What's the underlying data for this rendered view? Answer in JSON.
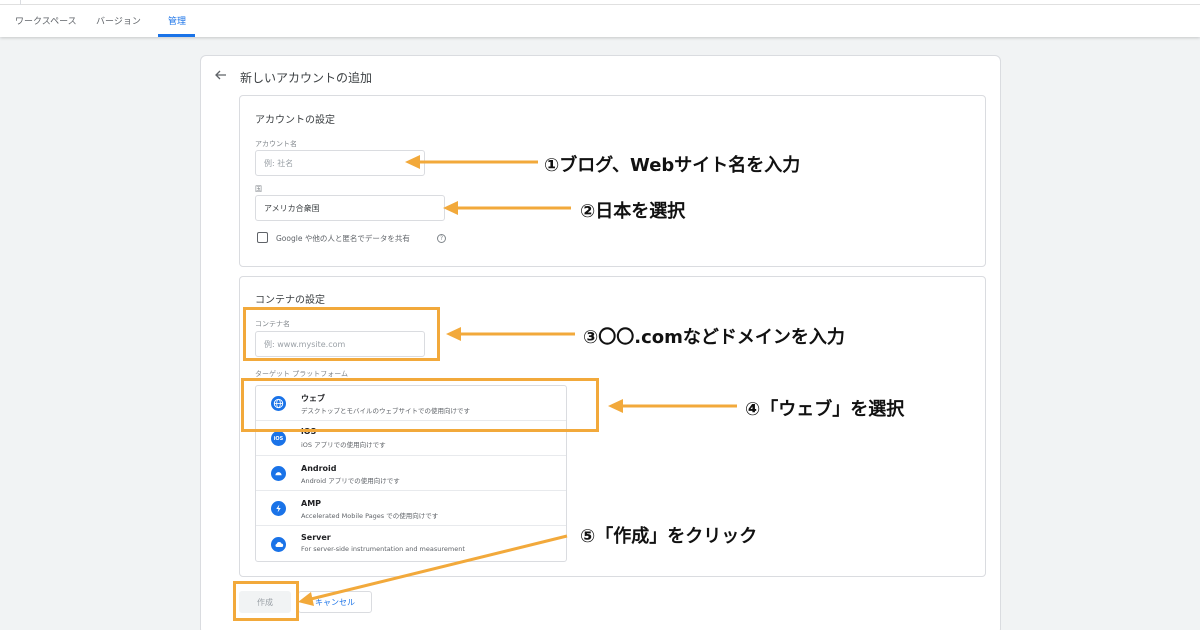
{
  "header": {
    "tabs": [
      {
        "label": "ワークスペース"
      },
      {
        "label": "バージョン"
      },
      {
        "label": "管理"
      }
    ],
    "active_tab": "管理"
  },
  "page": {
    "title": "新しいアカウントの追加"
  },
  "account_section": {
    "title": "アカウントの設定",
    "name_label": "アカウント名",
    "name_placeholder": "例: 社名",
    "country_label": "国",
    "country_value": "アメリカ合衆国",
    "share_label": "Google や他の人と匿名でデータを共有"
  },
  "container_section": {
    "title": "コンテナの設定",
    "name_label": "コンテナ名",
    "name_placeholder": "例: www.mysite.com",
    "platform_label": "ターゲット プラットフォーム",
    "platforms": [
      {
        "name": "ウェブ",
        "desc": "デスクトップとモバイルのウェブサイトでの使用向けです",
        "icon": "globe-icon"
      },
      {
        "name": "iOS",
        "desc": "iOS アプリでの使用向けです",
        "icon": "ios-icon"
      },
      {
        "name": "Android",
        "desc": "Android アプリでの使用向けです",
        "icon": "android-icon"
      },
      {
        "name": "AMP",
        "desc": "Accelerated Mobile Pages での使用向けです",
        "icon": "amp-bolt-icon"
      },
      {
        "name": "Server",
        "desc": "For server-side instrumentation and measurement",
        "icon": "cloud-icon"
      }
    ]
  },
  "buttons": {
    "create": "作成",
    "cancel": "キャンセル"
  },
  "annotations": {
    "a1": "①ブログ、Webサイト名を入力",
    "a2": "②日本を選択",
    "a3": "③〇〇.comなどドメインを入力",
    "a4": "④「ウェブ」を選択",
    "a5": "⑤「作成」をクリック"
  },
  "colors": {
    "accent": "#1a73e8",
    "annotation": "#f2a93b"
  }
}
